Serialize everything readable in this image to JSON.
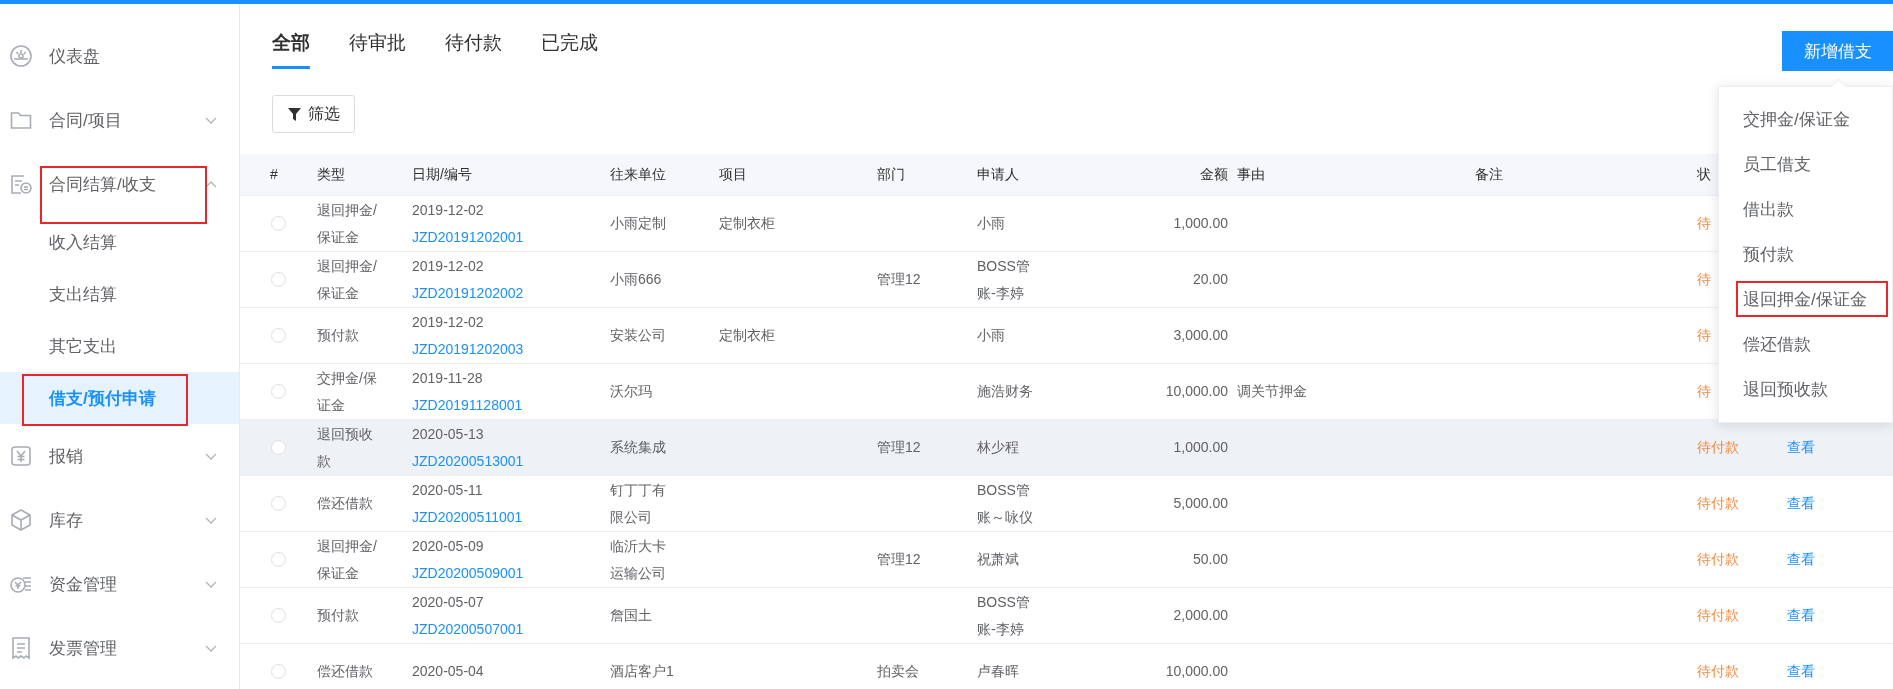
{
  "sidebar": {
    "items": [
      {
        "label": "仪表盘",
        "kind": "link"
      },
      {
        "label": "合同/项目",
        "kind": "group",
        "expanded": false
      },
      {
        "label": "合同结算/收支",
        "kind": "group",
        "expanded": true,
        "annotated": true,
        "children": [
          {
            "label": "收入结算",
            "selected": false,
            "annotated": false
          },
          {
            "label": "支出结算",
            "selected": false,
            "annotated": false
          },
          {
            "label": "其它支出",
            "selected": false,
            "annotated": false
          },
          {
            "label": "借支/预付申请",
            "selected": true,
            "annotated": true
          }
        ]
      },
      {
        "label": "报销",
        "kind": "group",
        "expanded": false
      },
      {
        "label": "库存",
        "kind": "group",
        "expanded": false
      },
      {
        "label": "资金管理",
        "kind": "group",
        "expanded": false
      },
      {
        "label": "发票管理",
        "kind": "group",
        "expanded": false
      }
    ]
  },
  "tabs": [
    {
      "label": "全部",
      "selected": true
    },
    {
      "label": "待审批",
      "selected": false
    },
    {
      "label": "待付款",
      "selected": false
    },
    {
      "label": "已完成",
      "selected": false
    }
  ],
  "filter_button": {
    "label": "筛选"
  },
  "new_button": {
    "label": "新增借支"
  },
  "new_menu": {
    "items": [
      {
        "label": "交押金/保证金",
        "annotated": false
      },
      {
        "label": "员工借支",
        "annotated": false
      },
      {
        "label": "借出款",
        "annotated": false
      },
      {
        "label": "预付款",
        "annotated": false
      },
      {
        "label": "退回押金/保证金",
        "annotated": true
      },
      {
        "label": "偿还借款",
        "annotated": false
      },
      {
        "label": "退回预收款",
        "annotated": false
      }
    ]
  },
  "table": {
    "columns": [
      "#",
      "类型",
      "日期/编号",
      "往来单位",
      "项目",
      "部门",
      "申请人",
      "金额",
      "事由",
      "备注",
      "状"
    ],
    "rows": [
      {
        "selected": false,
        "hovered": false,
        "type": "退回押金/保证金",
        "date": "2019-12-02",
        "code": "JZD20191202001",
        "company": "小雨定制",
        "project": "定制衣柜",
        "applicant": "小雨",
        "amount": "1,000.00",
        "status": "待"
      },
      {
        "selected": false,
        "hovered": false,
        "type": "退回押金/保证金",
        "date": "2019-12-02",
        "code": "JZD20191202002",
        "company": "小雨666",
        "department": "管理12",
        "applicant": "BOSS管账-李婷",
        "amount": "20.00",
        "status": "待"
      },
      {
        "selected": false,
        "hovered": false,
        "type": "预付款",
        "date": "2019-12-02",
        "code": "JZD20191202003",
        "company": "安装公司",
        "project": "定制衣柜",
        "applicant": "小雨",
        "amount": "3,000.00",
        "status": "待"
      },
      {
        "selected": false,
        "hovered": false,
        "type": "交押金/保证金",
        "date": "2019-11-28",
        "code": "JZD20191128001",
        "company": "沃尔玛",
        "applicant": "施浩财务",
        "amount": "10,000.00",
        "reason": "调关节押金",
        "status": "待"
      },
      {
        "selected": false,
        "hovered": true,
        "type": "退回预收款",
        "date": "2020-05-13",
        "code": "JZD20200513001",
        "company": "系统集成",
        "department": "管理12",
        "applicant": "林少程",
        "amount": "1,000.00",
        "status": "待付款",
        "action": "查看"
      },
      {
        "selected": false,
        "hovered": false,
        "type": "偿还借款",
        "date": "2020-05-11",
        "code": "JZD20200511001",
        "company": "钉丁丁有限公司",
        "applicant": "BOSS管账～咏仪",
        "amount": "5,000.00",
        "status": "待付款",
        "action": "查看"
      },
      {
        "selected": false,
        "hovered": false,
        "type": "退回押金/保证金",
        "date": "2020-05-09",
        "code": "JZD20200509001",
        "company": "临沂大卡运输公司",
        "department": "管理12",
        "applicant": "祝萧斌",
        "amount": "50.00",
        "status": "待付款",
        "action": "查看"
      },
      {
        "selected": false,
        "hovered": false,
        "type": "预付款",
        "date": "2020-05-07",
        "code": "JZD20200507001",
        "company": "詹国土",
        "applicant": "BOSS管账-李婷",
        "amount": "2,000.00",
        "status": "待付款",
        "action": "查看"
      },
      {
        "selected": false,
        "hovered": false,
        "type": "偿还借款",
        "date": "2020-05-04",
        "company": "酒店客户1",
        "department": "拍卖会",
        "applicant": "卢春晖",
        "amount": "10,000.00",
        "status": "待付款",
        "action": "查看"
      }
    ]
  }
}
